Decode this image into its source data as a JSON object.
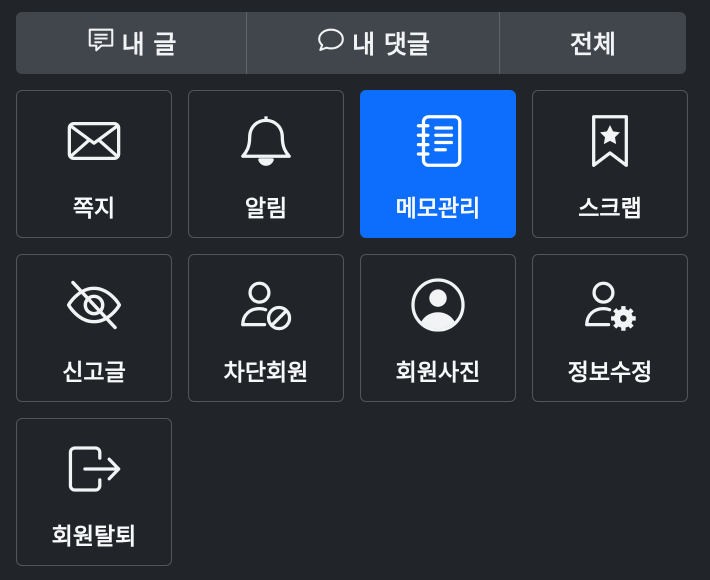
{
  "tabs": [
    {
      "label": "내 글",
      "icon": "post-icon"
    },
    {
      "label": "내 댓글",
      "icon": "comment-icon"
    },
    {
      "label": "전체"
    }
  ],
  "tiles": [
    {
      "label": "쪽지",
      "icon": "envelope-icon"
    },
    {
      "label": "알림",
      "icon": "bell-icon"
    },
    {
      "label": "메모관리",
      "icon": "notebook-icon",
      "active": true
    },
    {
      "label": "스크랩",
      "icon": "bookmark-star-icon"
    },
    {
      "label": "신고글",
      "icon": "eye-slash-icon"
    },
    {
      "label": "차단회원",
      "icon": "person-slash-icon"
    },
    {
      "label": "회원사진",
      "icon": "person-circle-icon"
    },
    {
      "label": "정보수정",
      "icon": "person-gear-icon"
    },
    {
      "label": "회원탈퇴",
      "icon": "box-arrow-right-icon"
    }
  ],
  "colors": {
    "background": "#212529",
    "tab_bg": "#41464c",
    "active_tile": "#0d6efd",
    "tile_border": "#50565c"
  }
}
